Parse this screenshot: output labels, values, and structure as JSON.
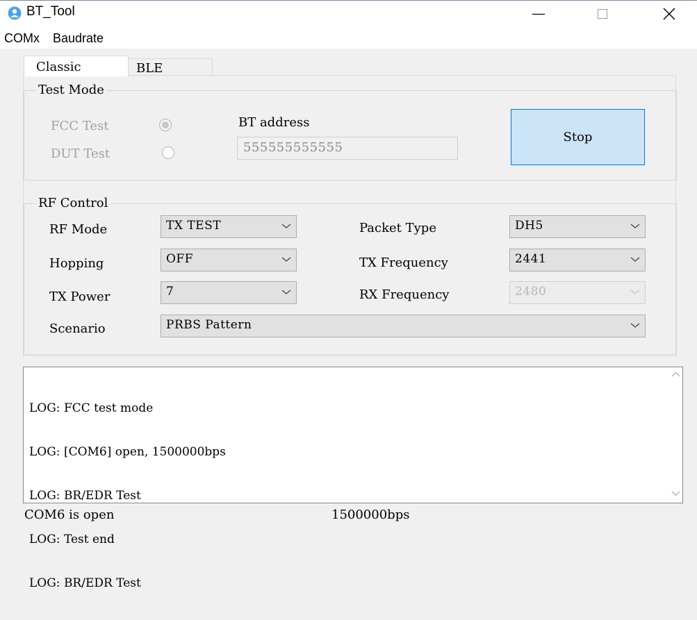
{
  "window": {
    "title": "BT_Tool",
    "icon": "user-icon",
    "accent_color": "#0078d7"
  },
  "menu": {
    "items": [
      "COMx",
      "Baudrate"
    ]
  },
  "tabs": [
    {
      "label": "Classic",
      "active": true
    },
    {
      "label": "BLE",
      "active": false
    }
  ],
  "test_mode": {
    "title": "Test Mode",
    "fcc_label": "FCC Test",
    "fcc_checked": true,
    "dut_label": "DUT Test",
    "dut_checked": false,
    "bt_address_label": "BT address",
    "bt_address_value": "555555555555",
    "stop_label": "Stop"
  },
  "rf_control": {
    "title": "RF Control",
    "rf_mode": {
      "label": "RF Mode",
      "value": "TX TEST"
    },
    "hopping": {
      "label": "Hopping",
      "value": "OFF"
    },
    "tx_power": {
      "label": "TX Power",
      "value": "7"
    },
    "scenario": {
      "label": "Scenario",
      "value": "PRBS Pattern"
    },
    "packet_type": {
      "label": "Packet Type",
      "value": "DH5"
    },
    "tx_frequency": {
      "label": "TX Frequency",
      "value": "2441"
    },
    "rx_frequency": {
      "label": "RX Frequency",
      "value": "2480",
      "disabled": true
    }
  },
  "log": {
    "lines": [
      "LOG: FCC test mode",
      "LOG: [COM6] open, 1500000bps",
      "LOG: BR/EDR Test",
      "LOG: Test end",
      "LOG: BR/EDR Test"
    ]
  },
  "status": {
    "port": "COM6 is open",
    "baud": "1500000bps"
  }
}
